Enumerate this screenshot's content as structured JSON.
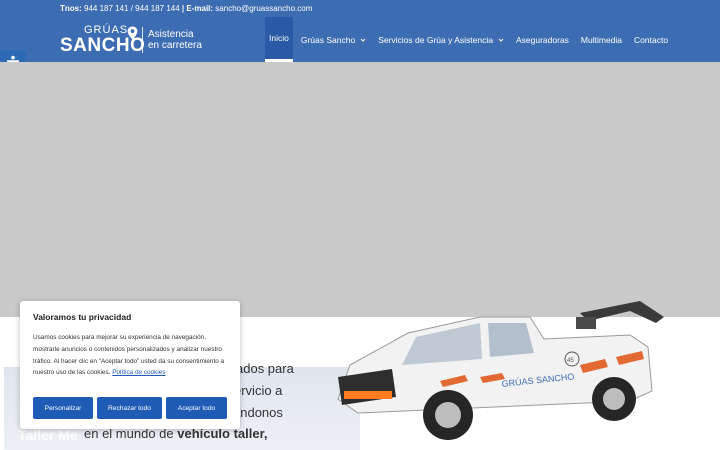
{
  "topbar": {
    "phones_label": "Tnos:",
    "phones": "944 187 141 / 944 187 144",
    "separator": "|",
    "email_label": "E-mail:",
    "email": "sancho@gruassancho.com"
  },
  "logo": {
    "top_word": "GRÚAS",
    "main_word": "SANCHO",
    "tagline_1": "Asistencia",
    "tagline_2": "en carretera"
  },
  "nav": {
    "items": [
      {
        "label": "Inicio",
        "active": true,
        "has_dropdown": false
      },
      {
        "label": "Grúas Sancho",
        "active": false,
        "has_dropdown": true
      },
      {
        "label": "Servicios de Grúa y Asistencia",
        "active": false,
        "has_dropdown": true
      },
      {
        "label": "Aseguradoras",
        "active": false,
        "has_dropdown": false
      },
      {
        "label": "Multimedia",
        "active": false,
        "has_dropdown": false
      },
      {
        "label": "Contacto",
        "active": false,
        "has_dropdown": false
      }
    ]
  },
  "accessibility": {
    "icon": "accessibility-icon"
  },
  "content": {
    "line_1": "ados para",
    "line_2": "ervicio a",
    "line_3": "ándonos",
    "line_4_prefix": "en el mundo de ",
    "line_4_bold": "vehículo taller,",
    "photo_label": "Taller Me"
  },
  "truck": {
    "brand_text": "GRÚAS SANCHO",
    "badge_text": "45"
  },
  "cookie": {
    "title": "Valoramos tu privacidad",
    "text": "Usamos cookies para mejorar su experiencia de navegación, mostrarle anuncios o contenidos personalizados y analizar nuestro tráfico. Al hacer clic en “Aceptar todo” usted da su consentimiento a nuestro uso de las cookies.",
    "policy_link": "Política de cookies",
    "buttons": {
      "customize": "Personalizar",
      "reject": "Rechazar todo",
      "accept": "Aceptar todo"
    }
  },
  "colors": {
    "header_blue": "#3c6db3",
    "nav_active": "#2a59a6",
    "button_blue": "#1d5bb5",
    "hero_grey": "#c9c9c9"
  }
}
